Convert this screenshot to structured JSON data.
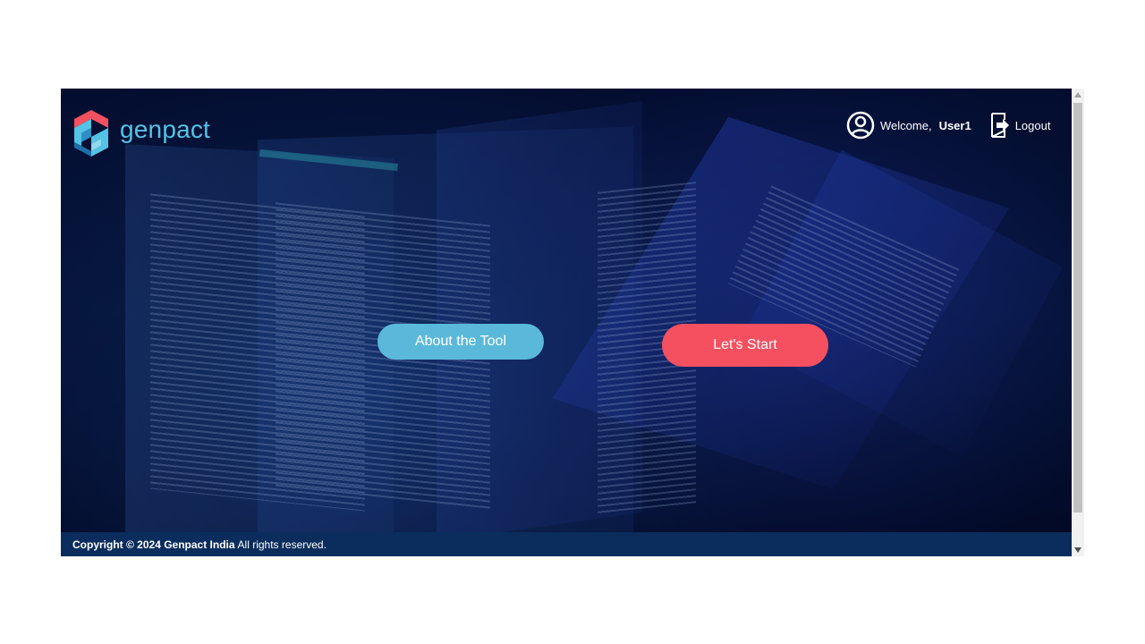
{
  "header": {
    "brand_name": "genpact",
    "welcome_label": "Welcome,",
    "username": "User1",
    "logout_label": "Logout"
  },
  "main": {
    "about_button_label": "About the Tool",
    "start_button_label": "Let's Start"
  },
  "footer": {
    "copyright_bold": "Copyright © 2024 Genpact India",
    "copyright_rest": "All rights reserved."
  },
  "icons": {
    "logo": "genpact-logo-icon",
    "user": "user-circle-icon",
    "logout": "logout-icon",
    "scroll_up": "arrow-up-icon",
    "scroll_down": "arrow-down-icon"
  },
  "colors": {
    "background": "#020c2c",
    "about_button": "#5ab9db",
    "start_button": "#f5505f",
    "footer": "#0b2d5d",
    "brand_text": "#53c3e6"
  }
}
